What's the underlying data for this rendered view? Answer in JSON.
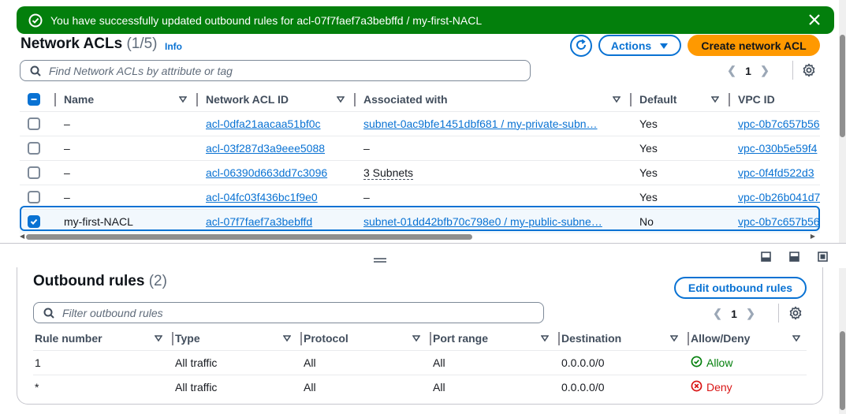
{
  "flash": {
    "message": "You have successfully updated outbound rules for acl-07f7faef7a3bebffd / my-first-NACL",
    "status_color": "#037f0c",
    "icons": {
      "status": "check-circle-icon",
      "close": "close-icon"
    }
  },
  "header": {
    "title": "Network ACLs",
    "count": "(1/5)",
    "info_label": "Info",
    "actions_label": "Actions",
    "create_label": "Create network ACL",
    "refresh_icon": "refresh-icon",
    "accent_color": "#0972d3",
    "primary_color": "#ff9900"
  },
  "search": {
    "placeholder": "Find Network ACLs by attribute or tag"
  },
  "pagination": {
    "page": "1"
  },
  "acl_table": {
    "columns": [
      "Name",
      "Network ACL ID",
      "Associated with",
      "Default",
      "VPC ID"
    ],
    "rows": [
      {
        "name": "–",
        "acl_id": "acl-0dfa21aacaa51bf0c",
        "associated": "subnet-0ac9bfe1451dbf681 / my-private-subn…",
        "default": "Yes",
        "vpc": "vpc-0b7c657b56",
        "selected": false
      },
      {
        "name": "–",
        "acl_id": "acl-03f287d3a9eee5088",
        "associated": "–",
        "default": "Yes",
        "vpc": "vpc-030b5e59f4",
        "selected": false
      },
      {
        "name": "–",
        "acl_id": "acl-06390d663dd7c3096",
        "associated": "3 Subnets",
        "default": "Yes",
        "vpc": "vpc-0f4fd522d3",
        "selected": false
      },
      {
        "name": "–",
        "acl_id": "acl-04fc03f436bc1f9e0",
        "associated": "–",
        "default": "Yes",
        "vpc": "vpc-0b26b041d7",
        "selected": false
      },
      {
        "name": "my-first-NACL",
        "acl_id": "acl-07f7faef7a3bebffd",
        "associated": "subnet-01dd42bfb70c798e0 / my-public-subne…",
        "default": "No",
        "vpc": "vpc-0b7c657b56",
        "selected": true
      }
    ]
  },
  "outbound": {
    "title": "Outbound rules",
    "count": "(2)",
    "edit_label": "Edit outbound rules",
    "search_placeholder": "Filter outbound rules",
    "page": "1",
    "columns": [
      "Rule number",
      "Type",
      "Protocol",
      "Port range",
      "Destination",
      "Allow/Deny"
    ],
    "rows": [
      {
        "rule": "1",
        "type": "All traffic",
        "protocol": "All",
        "port": "All",
        "destination": "0.0.0.0/0",
        "action": "Allow"
      },
      {
        "rule": "*",
        "type": "All traffic",
        "protocol": "All",
        "port": "All",
        "destination": "0.0.0.0/0",
        "action": "Deny"
      }
    ],
    "allow_color": "#037f0c",
    "deny_color": "#d91515"
  }
}
